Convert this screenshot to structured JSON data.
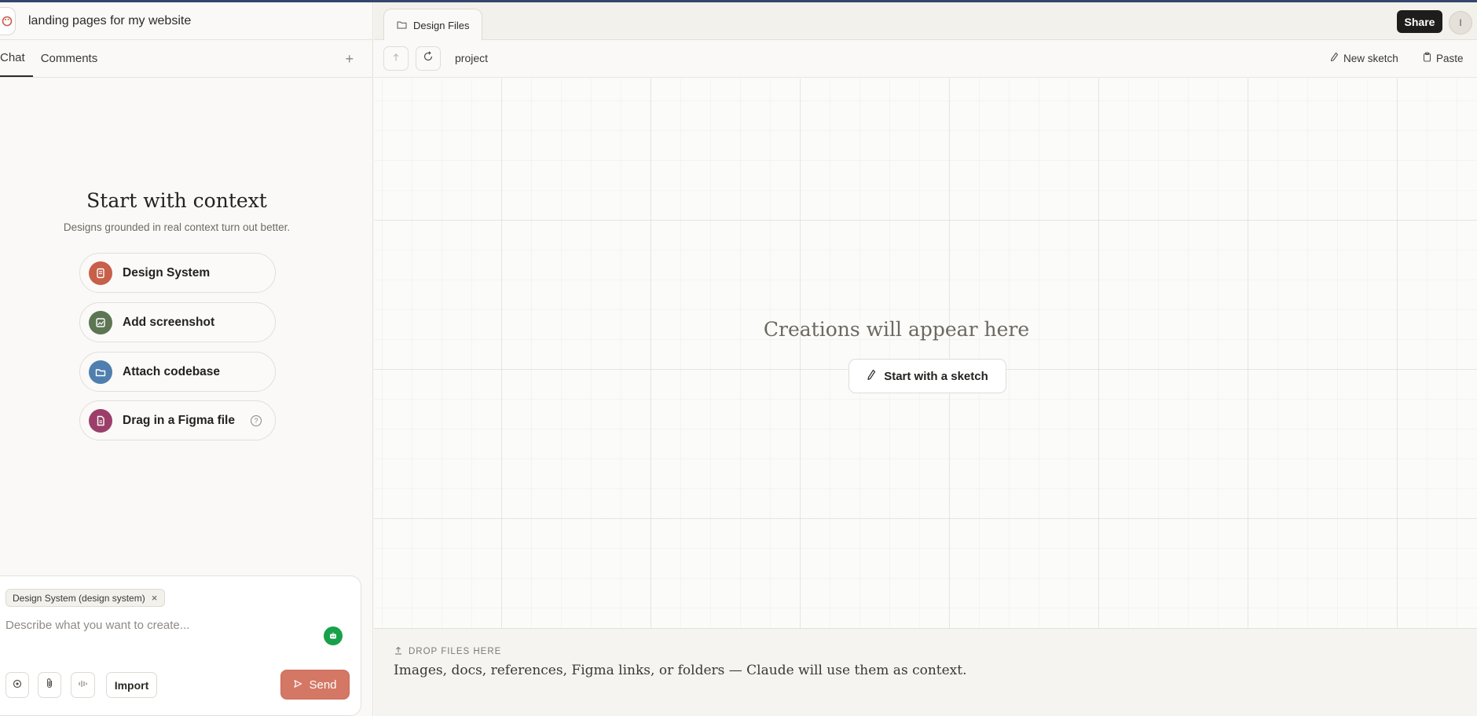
{
  "project": {
    "title": "landing pages for my website"
  },
  "left_tabs": {
    "chat": "Chat",
    "comments": "Comments",
    "add": "+"
  },
  "context": {
    "title": "Start with context",
    "subtitle": "Designs grounded in real context turn out better.",
    "options": [
      {
        "label": "Design System",
        "icon": "design-system-icon",
        "color": "#c75f49"
      },
      {
        "label": "Add screenshot",
        "icon": "image-icon",
        "color": "#5c7553"
      },
      {
        "label": "Attach codebase",
        "icon": "folder-icon",
        "color": "#4f7fae"
      },
      {
        "label": "Drag in a Figma file",
        "icon": "document-icon",
        "color": "#9b3f6a",
        "help": "?"
      }
    ]
  },
  "composer": {
    "chip_label": "Design System (design system)",
    "chip_close": "×",
    "placeholder": "Describe what you want to create...",
    "import_label": "Import",
    "send_label": "Send"
  },
  "file_tabs": [
    {
      "label": "Design Files"
    }
  ],
  "header": {
    "share_label": "Share",
    "avatar_initial": "I"
  },
  "toolbar": {
    "crumb": "project",
    "new_sketch_label": "New sketch",
    "paste_label": "Paste"
  },
  "canvas": {
    "empty_title": "Creations will appear here",
    "sketch_button_label": "Start with a sketch"
  },
  "dropzone": {
    "heading": "DROP FILES HERE",
    "text": "Images, docs, references, Figma links, or folders — Claude will use them as context."
  }
}
